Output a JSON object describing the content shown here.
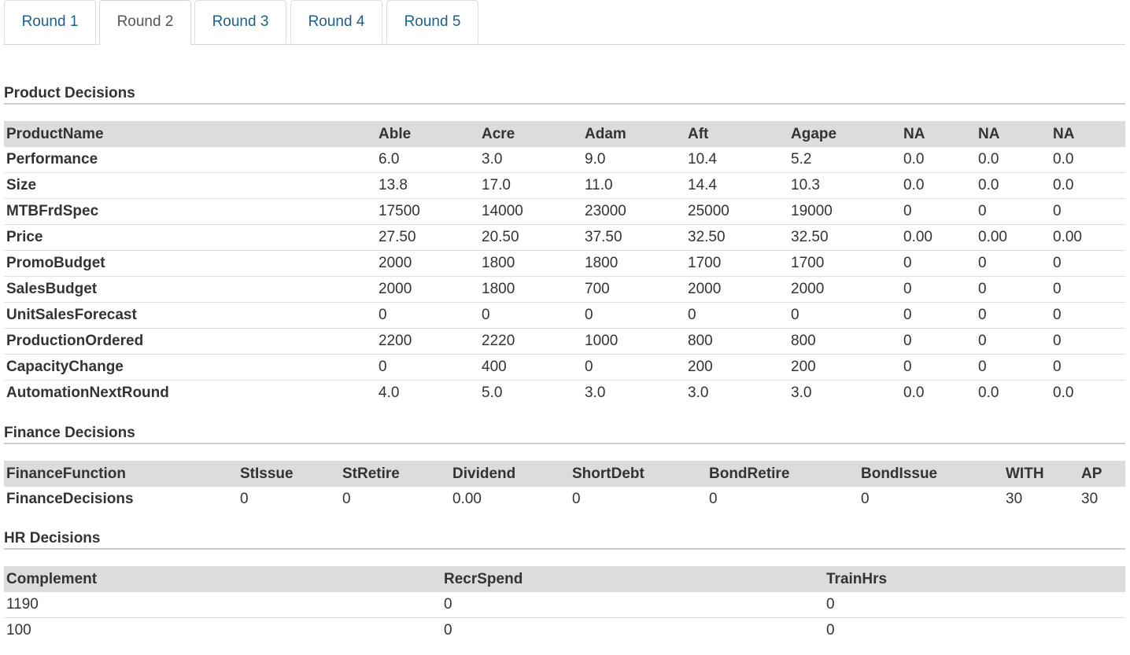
{
  "tabs": [
    "Round 1",
    "Round 2",
    "Round 3",
    "Round 4",
    "Round 5"
  ],
  "active_tab": 1,
  "product": {
    "title": "Product Decisions",
    "headers": [
      "ProductName",
      "Able",
      "Acre",
      "Adam",
      "Aft",
      "Agape",
      "NA",
      "NA",
      "NA"
    ],
    "rows": [
      [
        "Performance",
        "6.0",
        "3.0",
        "9.0",
        "10.4",
        "5.2",
        "0.0",
        "0.0",
        "0.0"
      ],
      [
        "Size",
        "13.8",
        "17.0",
        "11.0",
        "14.4",
        "10.3",
        "0.0",
        "0.0",
        "0.0"
      ],
      [
        "MTBFrdSpec",
        "17500",
        "14000",
        "23000",
        "25000",
        "19000",
        "0",
        "0",
        "0"
      ],
      [
        "Price",
        "27.50",
        "20.50",
        "37.50",
        "32.50",
        "32.50",
        "0.00",
        "0.00",
        "0.00"
      ],
      [
        "PromoBudget",
        "2000",
        "1800",
        "1800",
        "1700",
        "1700",
        "0",
        "0",
        "0"
      ],
      [
        "SalesBudget",
        "2000",
        "1800",
        "700",
        "2000",
        "2000",
        "0",
        "0",
        "0"
      ],
      [
        "UnitSalesForecast",
        "0",
        "0",
        "0",
        "0",
        "0",
        "0",
        "0",
        "0"
      ],
      [
        "ProductionOrdered",
        "2200",
        "2220",
        "1000",
        "800",
        "800",
        "0",
        "0",
        "0"
      ],
      [
        "CapacityChange",
        "0",
        "400",
        "0",
        "200",
        "200",
        "0",
        "0",
        "0"
      ],
      [
        "AutomationNextRound",
        "4.0",
        "5.0",
        "3.0",
        "3.0",
        "3.0",
        "0.0",
        "0.0",
        "0.0"
      ]
    ]
  },
  "finance": {
    "title": "Finance Decisions",
    "headers": [
      "FinanceFunction",
      "StIssue",
      "StRetire",
      "Dividend",
      "ShortDebt",
      "BondRetire",
      "BondIssue",
      "WITH",
      "AP"
    ],
    "rows": [
      [
        "FinanceDecisions",
        "0",
        "0",
        "0.00",
        "0",
        "0",
        "0",
        "30",
        "30"
      ]
    ]
  },
  "hr": {
    "title": "HR Decisions",
    "headers": [
      "Complement",
      "RecrSpend",
      "TrainHrs"
    ],
    "rows": [
      [
        "1190",
        "0",
        "0"
      ],
      [
        "100",
        "0",
        "0"
      ]
    ]
  }
}
